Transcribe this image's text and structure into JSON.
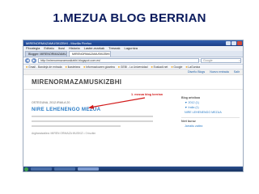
{
  "slide": {
    "title": "1.MEZUA BLOG BERRIAN"
  },
  "browser": {
    "window_title": "MIRENORMAZAMUSKIZBHI - Mozilla Firefox",
    "menu": [
      "Fitxategia",
      "Editatu",
      "Ikusi",
      "Historia",
      "Laster-markak",
      "Tresnak",
      "Laguntza"
    ],
    "tabs": [
      "Blogger: MIRENORMAZAMUSKIZBHI - Mezu...",
      "MIRENORMAZAMUSKIZBHI"
    ],
    "back_glyph": "◀",
    "forward_glyph": "▶",
    "url": "http://mirenormazamuskizbhi.blogspot.com.es/",
    "search_placeholder": "Google",
    "search_glyph": "⌕",
    "bookmarks": [
      "Gmail - Bandeja de entrada",
      "Ikastetxea",
      "Informazioaren gizartea",
      "GEBI - La Universidad",
      "Euskadi.net",
      "Google",
      "LaGuntza"
    ]
  },
  "blog": {
    "toolbar": [
      "Diseño Blogs",
      "Nuevo entrada",
      "Salir"
    ],
    "name": "MIRENORMAZAMUSKIZBHI",
    "post_date": "OSTEGUNA, 2012.IRAILA 20",
    "post_title": "NIRE LEHENENGO MEZUA",
    "post_meta": "Argitaratzailea: MIREN ORMAZA MUSKIZ • 0 iruzkin",
    "annotation": "1. mezua blog berrian",
    "sidebar": {
      "archive_heading": "Blog artxiboa",
      "archive_items": [
        "▼ 2012 (1)",
        "▼ Iraila (1)",
        "NIRE LEHENENGO MEZUA"
      ],
      "members_heading": "Neri buruz",
      "members_items": [
        "Jarraitu zaitez"
      ]
    }
  },
  "colors": {
    "title": "#0a1a5c",
    "accent": "#2a7cc7",
    "annotation": "#d21a1a"
  }
}
